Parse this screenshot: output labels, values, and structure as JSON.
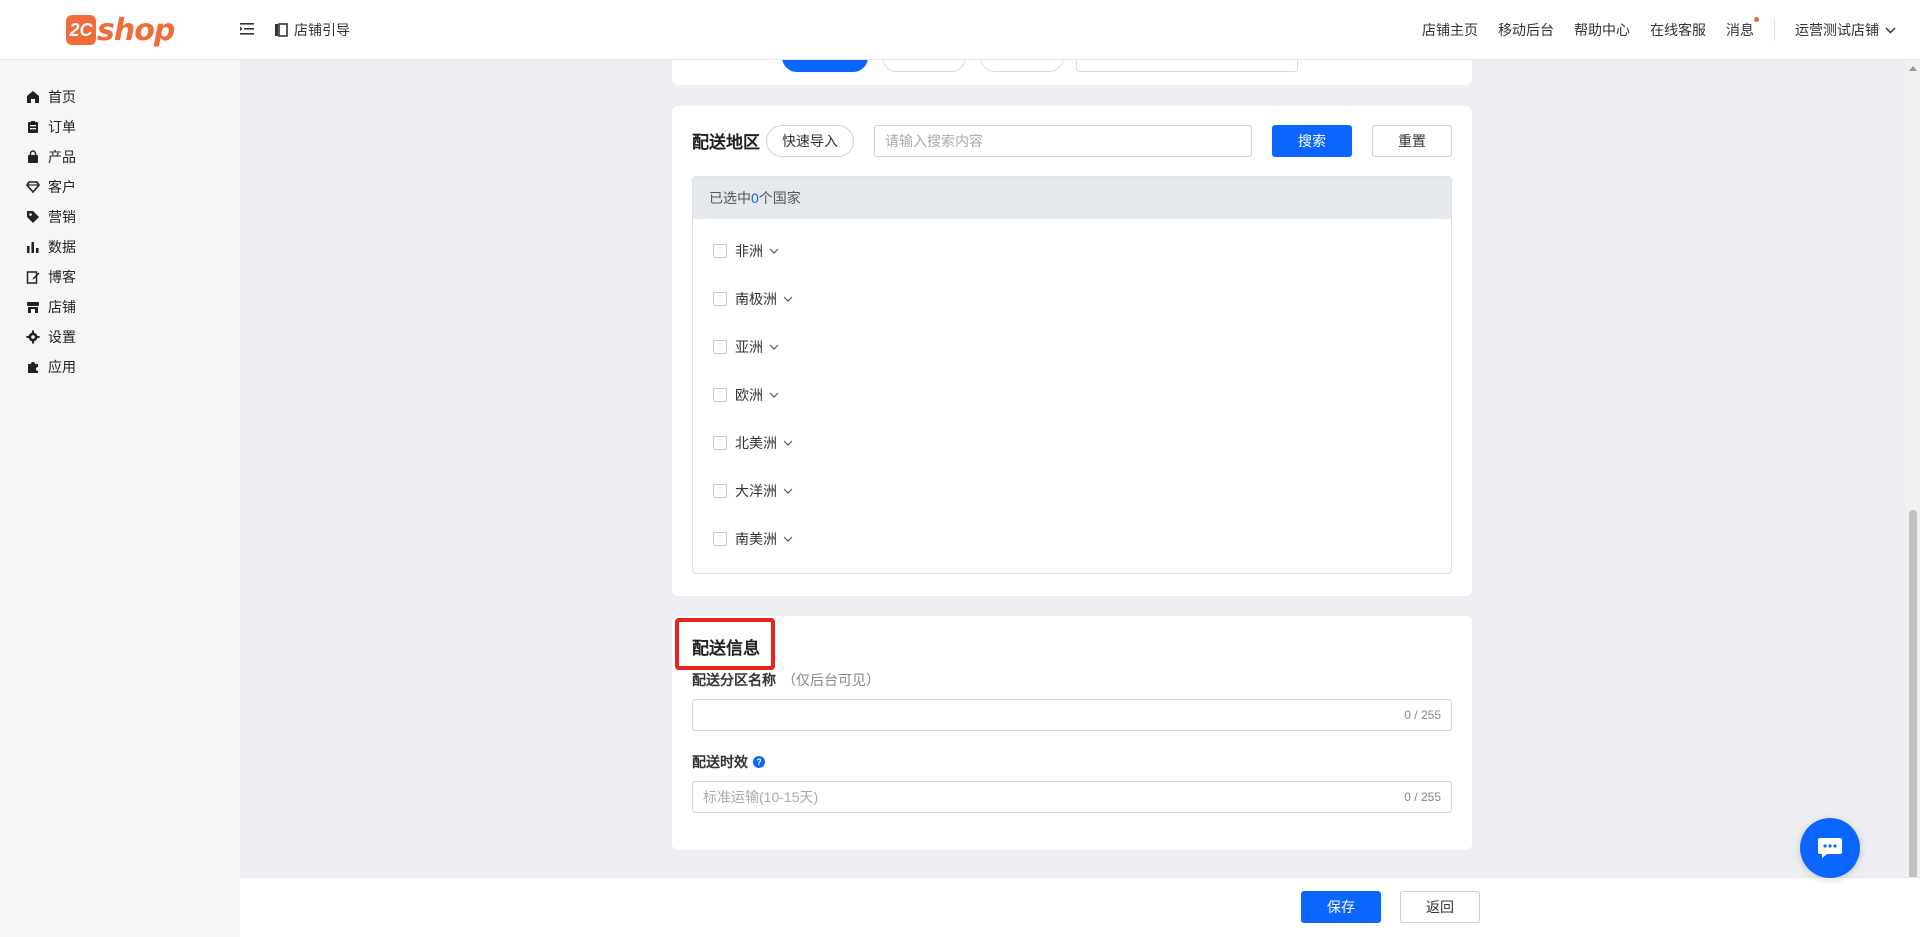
{
  "brand": {
    "logo_mark": "2C",
    "logo_text": "shop",
    "color": "#f26b3a"
  },
  "header": {
    "guide_label": "店铺引导",
    "nav": [
      "店铺主页",
      "移动后台",
      "帮助中心",
      "在线客服",
      "消息"
    ],
    "store_name": "运营测试店铺"
  },
  "sidebar": {
    "items": [
      {
        "label": "首页",
        "icon": "home-icon"
      },
      {
        "label": "订单",
        "icon": "clipboard-icon"
      },
      {
        "label": "产品",
        "icon": "bag-icon"
      },
      {
        "label": "客户",
        "icon": "diamond-icon"
      },
      {
        "label": "营销",
        "icon": "tag-icon"
      },
      {
        "label": "数据",
        "icon": "bar-chart-icon"
      },
      {
        "label": "博客",
        "icon": "edit-icon"
      },
      {
        "label": "店铺",
        "icon": "store-icon"
      },
      {
        "label": "设置",
        "icon": "gear-icon"
      },
      {
        "label": "应用",
        "icon": "puzzle-icon"
      }
    ]
  },
  "region": {
    "title": "配送地区",
    "quick_import": "快速导入",
    "search_placeholder": "请输入搜索内容",
    "search_label": "搜索",
    "reset_label": "重置",
    "selected_prefix": "已选中",
    "selected_count": "0",
    "selected_suffix": "个国家",
    "continents": [
      "非洲",
      "南极洲",
      "亚洲",
      "欧洲",
      "北美洲",
      "大洋洲",
      "南美洲"
    ]
  },
  "info": {
    "title": "配送信息",
    "zone_name_label": "配送分区名称",
    "zone_name_note": "（仅后台可见）",
    "zone_name_counter": "0 / 255",
    "timeliness_label": "配送时效",
    "timeliness_placeholder": "标准运输(10-15天)",
    "timeliness_counter": "0 / 255"
  },
  "footer": {
    "save_label": "保存",
    "back_label": "返回"
  },
  "colors": {
    "primary": "#0a66ff",
    "highlight": "#e8231b"
  }
}
